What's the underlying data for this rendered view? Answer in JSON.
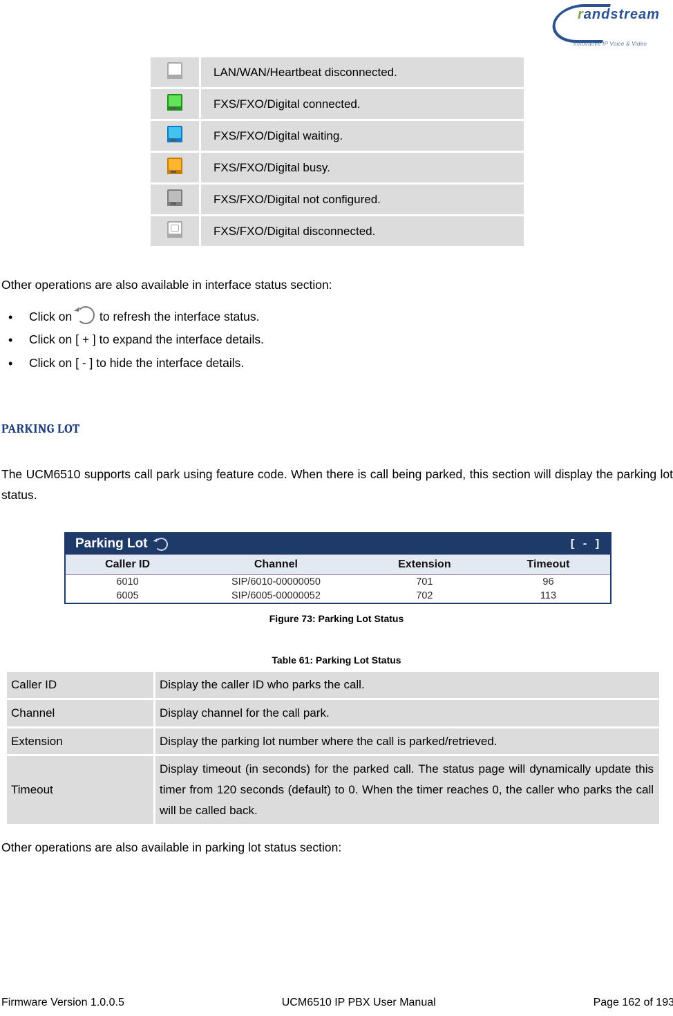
{
  "brand": {
    "name_styled": "randstream",
    "tagline": "Innovative IP Voice & Video"
  },
  "status_legend": [
    {
      "icon": "port-white",
      "label": "LAN/WAN/Heartbeat disconnected."
    },
    {
      "icon": "port-green",
      "label": "FXS/FXO/Digital connected."
    },
    {
      "icon": "port-blue",
      "label": "FXS/FXO/Digital waiting."
    },
    {
      "icon": "port-orange",
      "label": "FXS/FXO/Digital busy."
    },
    {
      "icon": "port-grey",
      "label": "FXS/FXO/Digital not configured."
    },
    {
      "icon": "port-disconn",
      "label": "FXS/FXO/Digital disconnected."
    }
  ],
  "body": {
    "other_ops_intro_1": "Other operations are also available in interface status section:",
    "bullet_refresh_prefix": "Click on ",
    "bullet_refresh_suffix": " to refresh the interface status.",
    "bullet_expand": "Click on [ + ] to expand the interface details.",
    "bullet_hide": "Click on [ - ] to hide the interface details.",
    "other_ops_intro_2": "Other operations are also available in parking lot status section:"
  },
  "section_heading": "PARKING LOT",
  "parking_intro": "The UCM6510 supports call park using feature code. When there is call being parked, this section will display the parking lot status.",
  "parking_widget": {
    "title": "Parking Lot",
    "collapse_label": "[ - ]",
    "columns": [
      "Caller ID",
      "Channel",
      "Extension",
      "Timeout"
    ],
    "rows": [
      {
        "caller_id": "6010",
        "channel": "SIP/6010-00000050",
        "extension": "701",
        "timeout": "96"
      },
      {
        "caller_id": "6005",
        "channel": "SIP/6005-00000052",
        "extension": "702",
        "timeout": "113"
      }
    ]
  },
  "captions": {
    "figure": "Figure 73: Parking Lot Status",
    "table": "Table 61: Parking Lot Status"
  },
  "desc_table": [
    {
      "key": "Caller ID",
      "val": "Display the caller ID who parks the call."
    },
    {
      "key": "Channel",
      "val": "Display channel for the call park."
    },
    {
      "key": "Extension",
      "val": "Display the parking lot number where the call is parked/retrieved."
    },
    {
      "key": "Timeout",
      "val": "Display timeout (in seconds) for the parked call. The status page will dynamically update this timer from 120 seconds (default) to 0. When the timer reaches 0, the caller who parks the call will be called back."
    }
  ],
  "footer": {
    "left": "Firmware Version 1.0.0.5",
    "center": "UCM6510 IP PBX User Manual",
    "right": "Page 162 of 193"
  }
}
